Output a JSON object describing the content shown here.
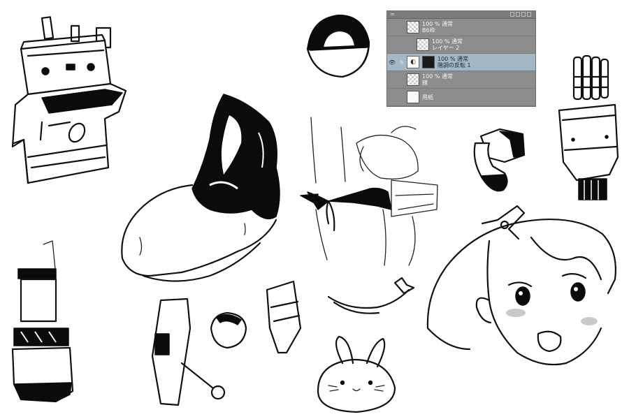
{
  "layer_panel": {
    "header_mark": "≈",
    "layers": [
      {
        "opacity_blend": "100 % 通常",
        "name": "B6枠",
        "type": "raster"
      },
      {
        "opacity_blend": "100 % 通常",
        "name": "レイヤー 2",
        "type": "folder"
      },
      {
        "opacity_blend": "100 % 通常",
        "name": "階調の反転 1",
        "type": "correction",
        "active": true
      },
      {
        "opacity_blend": "100 % 通常",
        "name": "線",
        "type": "raster"
      },
      {
        "opacity_blend": "",
        "name": "用紙",
        "type": "paper"
      }
    ]
  },
  "colors": {
    "ink": "#111111",
    "paper": "#ffffff",
    "panel_bg": "#8c8c8c",
    "panel_active": "#a3b7c5"
  }
}
